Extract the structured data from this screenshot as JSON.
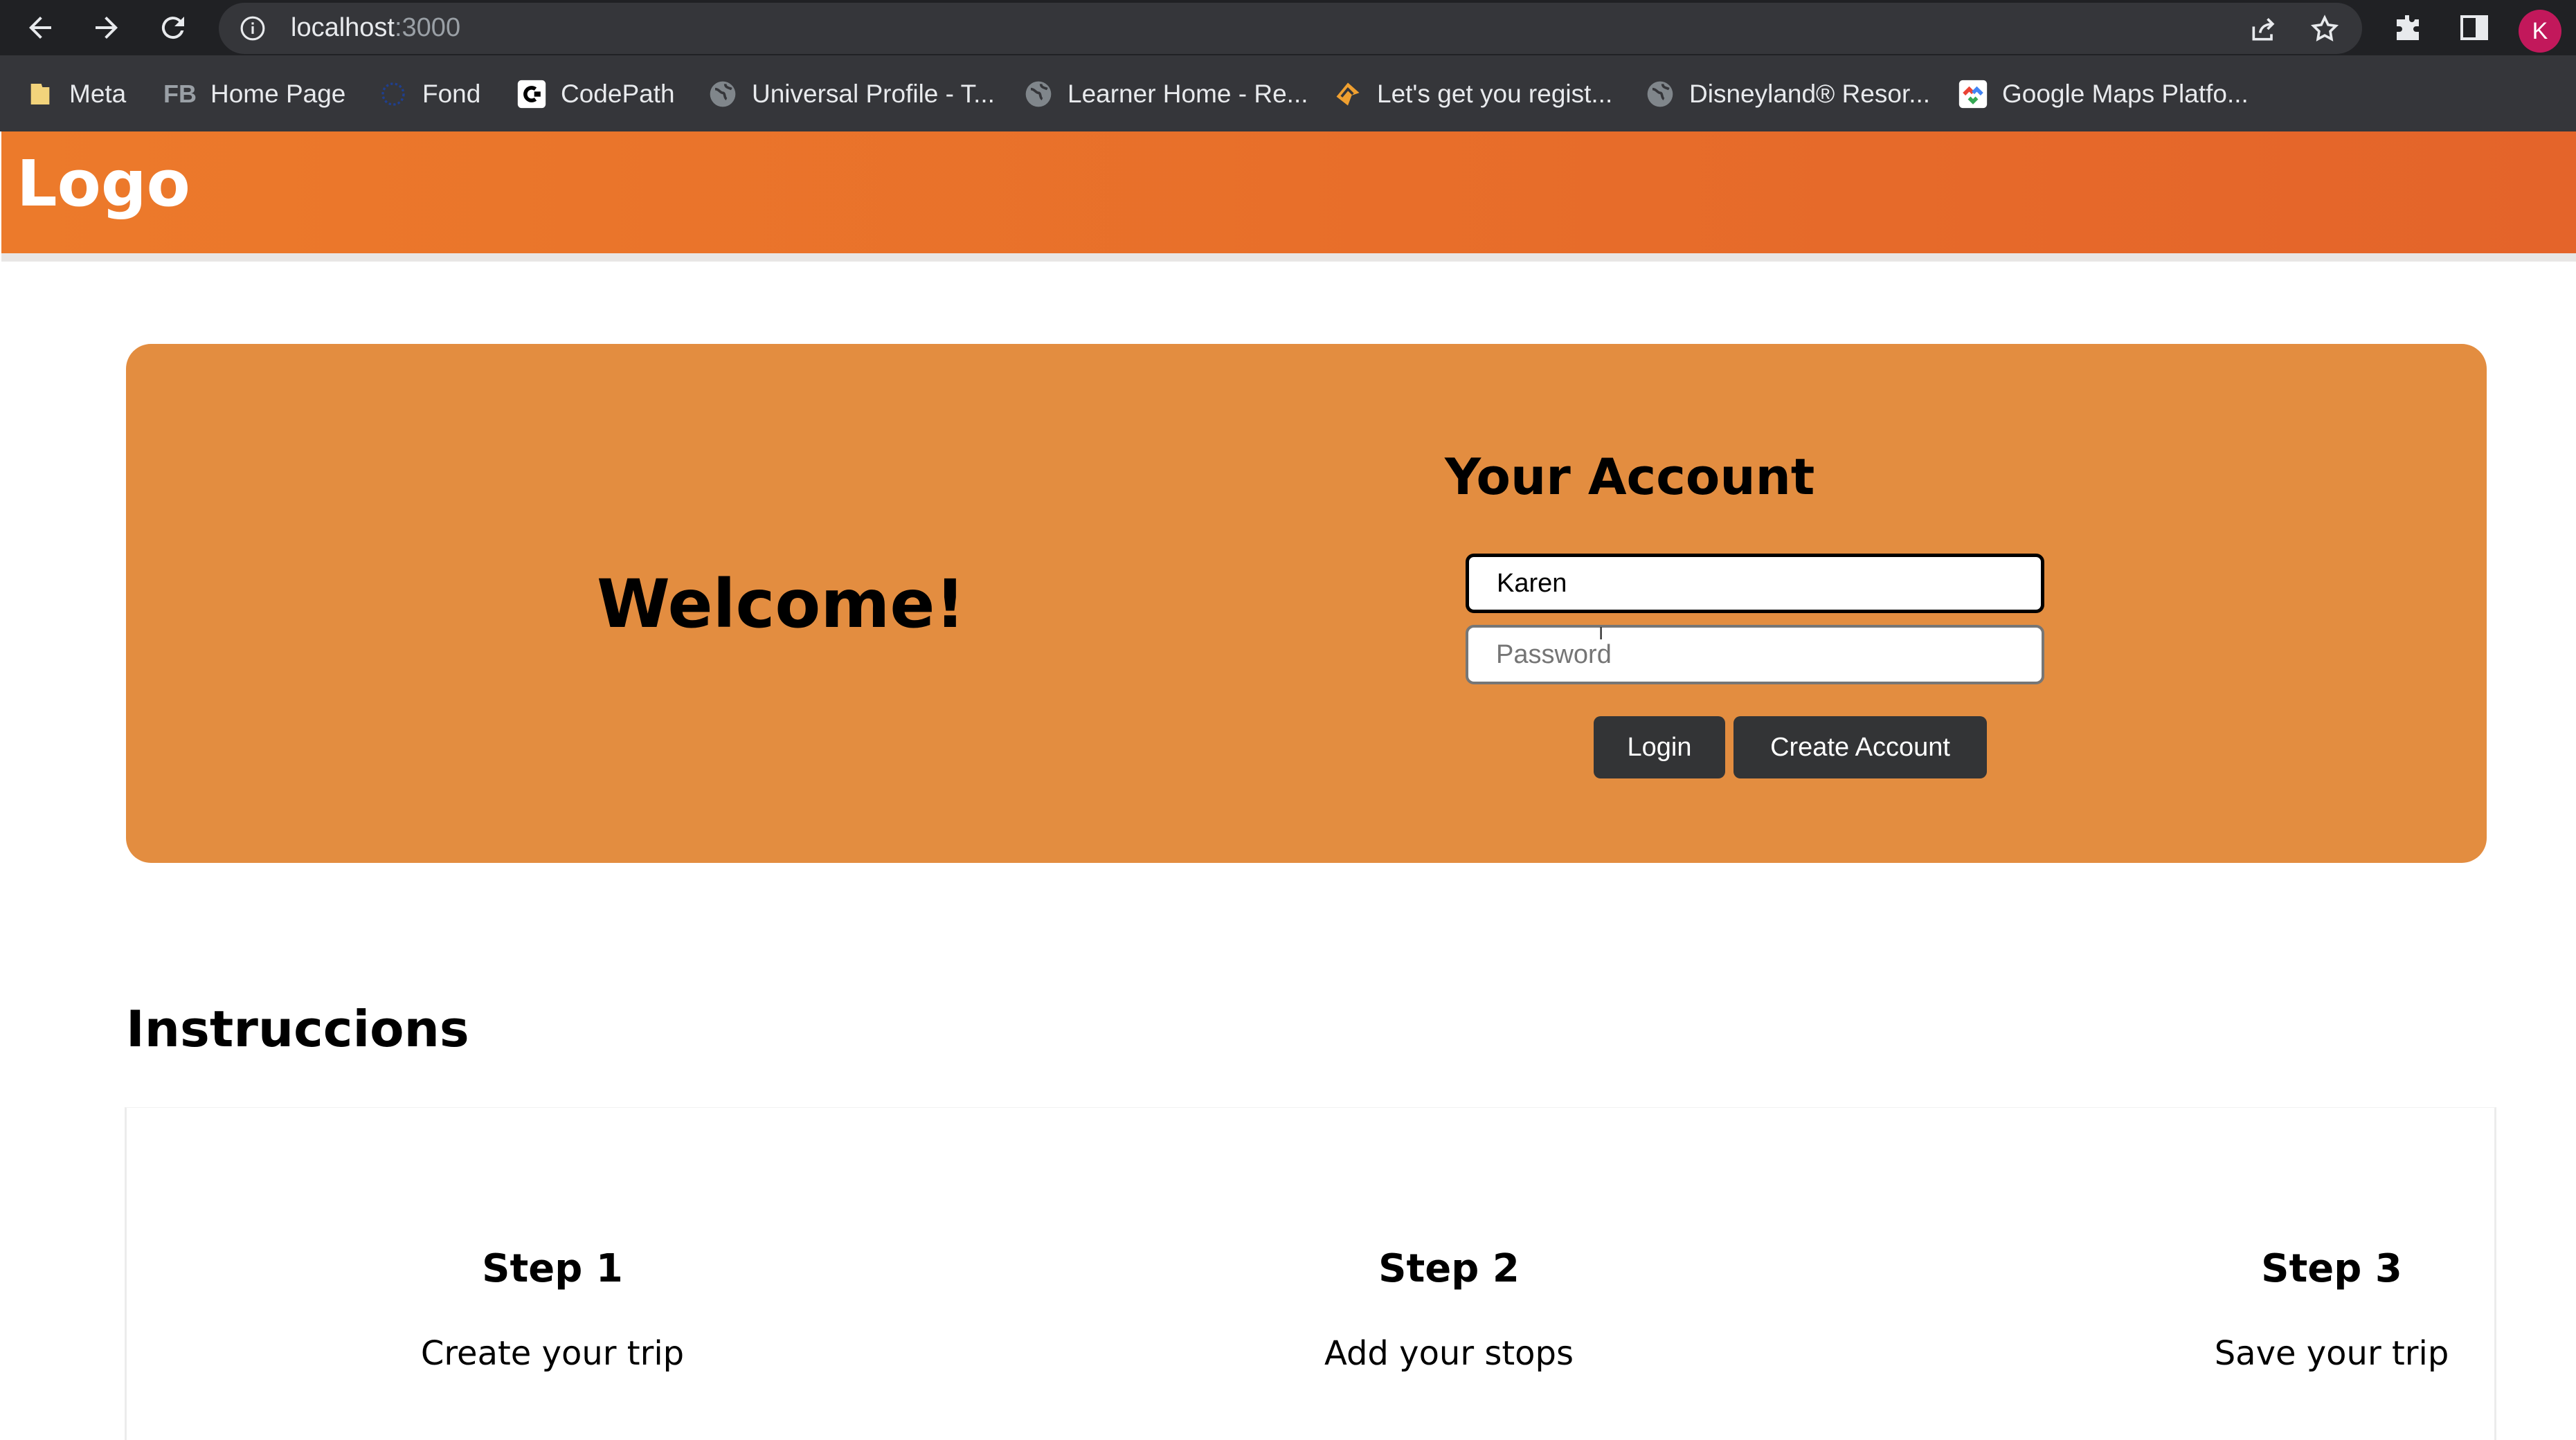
{
  "browser": {
    "url_host": "localhost",
    "url_port": ":3000",
    "profile_initial": "K",
    "bookmarks": [
      {
        "label": "Meta",
        "icon": "folder-icon"
      },
      {
        "label": "Home Page",
        "icon": "fb-icon",
        "prefix": "FB"
      },
      {
        "label": "Fond",
        "icon": "globe-dots-icon"
      },
      {
        "label": "CodePath",
        "icon": "codepath-icon"
      },
      {
        "label": "Universal Profile - T...",
        "icon": "globe-icon"
      },
      {
        "label": "Learner Home - Re...",
        "icon": "globe-icon"
      },
      {
        "label": "Let's get you regist...",
        "icon": "ticket-icon"
      },
      {
        "label": "Disneyland® Resor...",
        "icon": "globe-icon"
      },
      {
        "label": "Google Maps Platfo...",
        "icon": "google-maps-icon"
      }
    ]
  },
  "header": {
    "logo": "Logo"
  },
  "hero": {
    "welcome": "Welcome!",
    "account_title": "Your Account",
    "username_value": "Karen",
    "password_placeholder": "Password",
    "login_label": "Login",
    "create_label": "Create Account"
  },
  "instructions": {
    "title": "Instruccions",
    "steps": [
      {
        "title": "Step 1",
        "text": "Create your trip"
      },
      {
        "title": "Step 2",
        "text": "Add your stops"
      },
      {
        "title": "Step 3",
        "text": "Save your trip"
      }
    ]
  }
}
